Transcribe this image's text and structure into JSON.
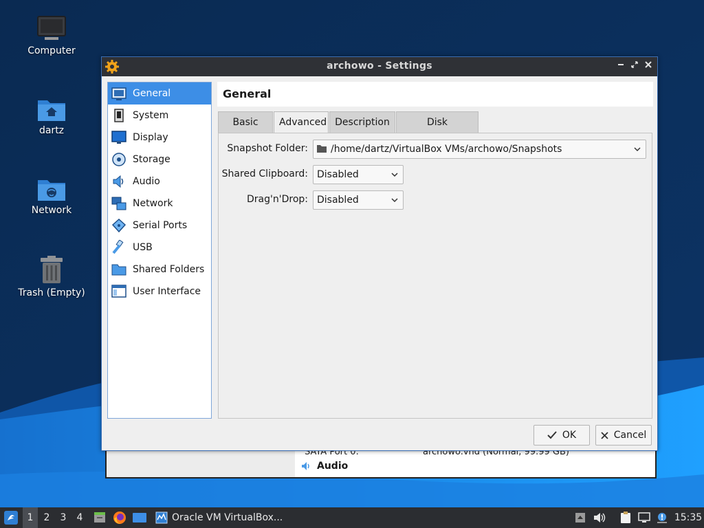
{
  "desktop": {
    "icons": [
      {
        "label": "Computer"
      },
      {
        "label": "dartz"
      },
      {
        "label": "Network"
      },
      {
        "label": "Trash (Empty)"
      }
    ]
  },
  "background_window": {
    "sata_port": "SATA Port 0:",
    "sata_value": "archowo.vhd (Normal, 99.99 GB)",
    "section": "Audio"
  },
  "dialog": {
    "title": "archowo - Settings",
    "sidebar": [
      {
        "label": "General",
        "icon": "general-icon",
        "active": true
      },
      {
        "label": "System",
        "icon": "system-icon"
      },
      {
        "label": "Display",
        "icon": "display-icon"
      },
      {
        "label": "Storage",
        "icon": "storage-icon"
      },
      {
        "label": "Audio",
        "icon": "audio-icon"
      },
      {
        "label": "Network",
        "icon": "network-icon"
      },
      {
        "label": "Serial Ports",
        "icon": "serial-ports-icon"
      },
      {
        "label": "USB",
        "icon": "usb-icon"
      },
      {
        "label": "Shared Folders",
        "icon": "shared-folders-icon"
      },
      {
        "label": "User Interface",
        "icon": "user-interface-icon"
      }
    ],
    "section_title": "General",
    "tabs": [
      {
        "label": "Basic"
      },
      {
        "label": "Advanced",
        "active": true
      },
      {
        "label": "Description"
      },
      {
        "label": "Disk Encryption"
      }
    ],
    "form": {
      "snapshot_label": "Snapshot Folder:",
      "snapshot_value": "/home/dartz/VirtualBox VMs/archowo/Snapshots",
      "clipboard_label": "Shared Clipboard:",
      "clipboard_value": "Disabled",
      "dragdrop_label": "Drag'n'Drop:",
      "dragdrop_value": "Disabled"
    },
    "buttons": {
      "ok": "OK",
      "cancel": "Cancel"
    }
  },
  "taskbar": {
    "workspaces": [
      "1",
      "2",
      "3",
      "4"
    ],
    "active_workspace": "1",
    "window_button": "Oracle VM VirtualBox...",
    "clock": "15:35"
  },
  "colors": {
    "accent": "#3d8ee6",
    "titlebar": "#2f3136",
    "taskbar": "#2b2d31",
    "wallpaper_dark": "#0a2b55",
    "wallpaper_light": "#1b8ee8"
  }
}
